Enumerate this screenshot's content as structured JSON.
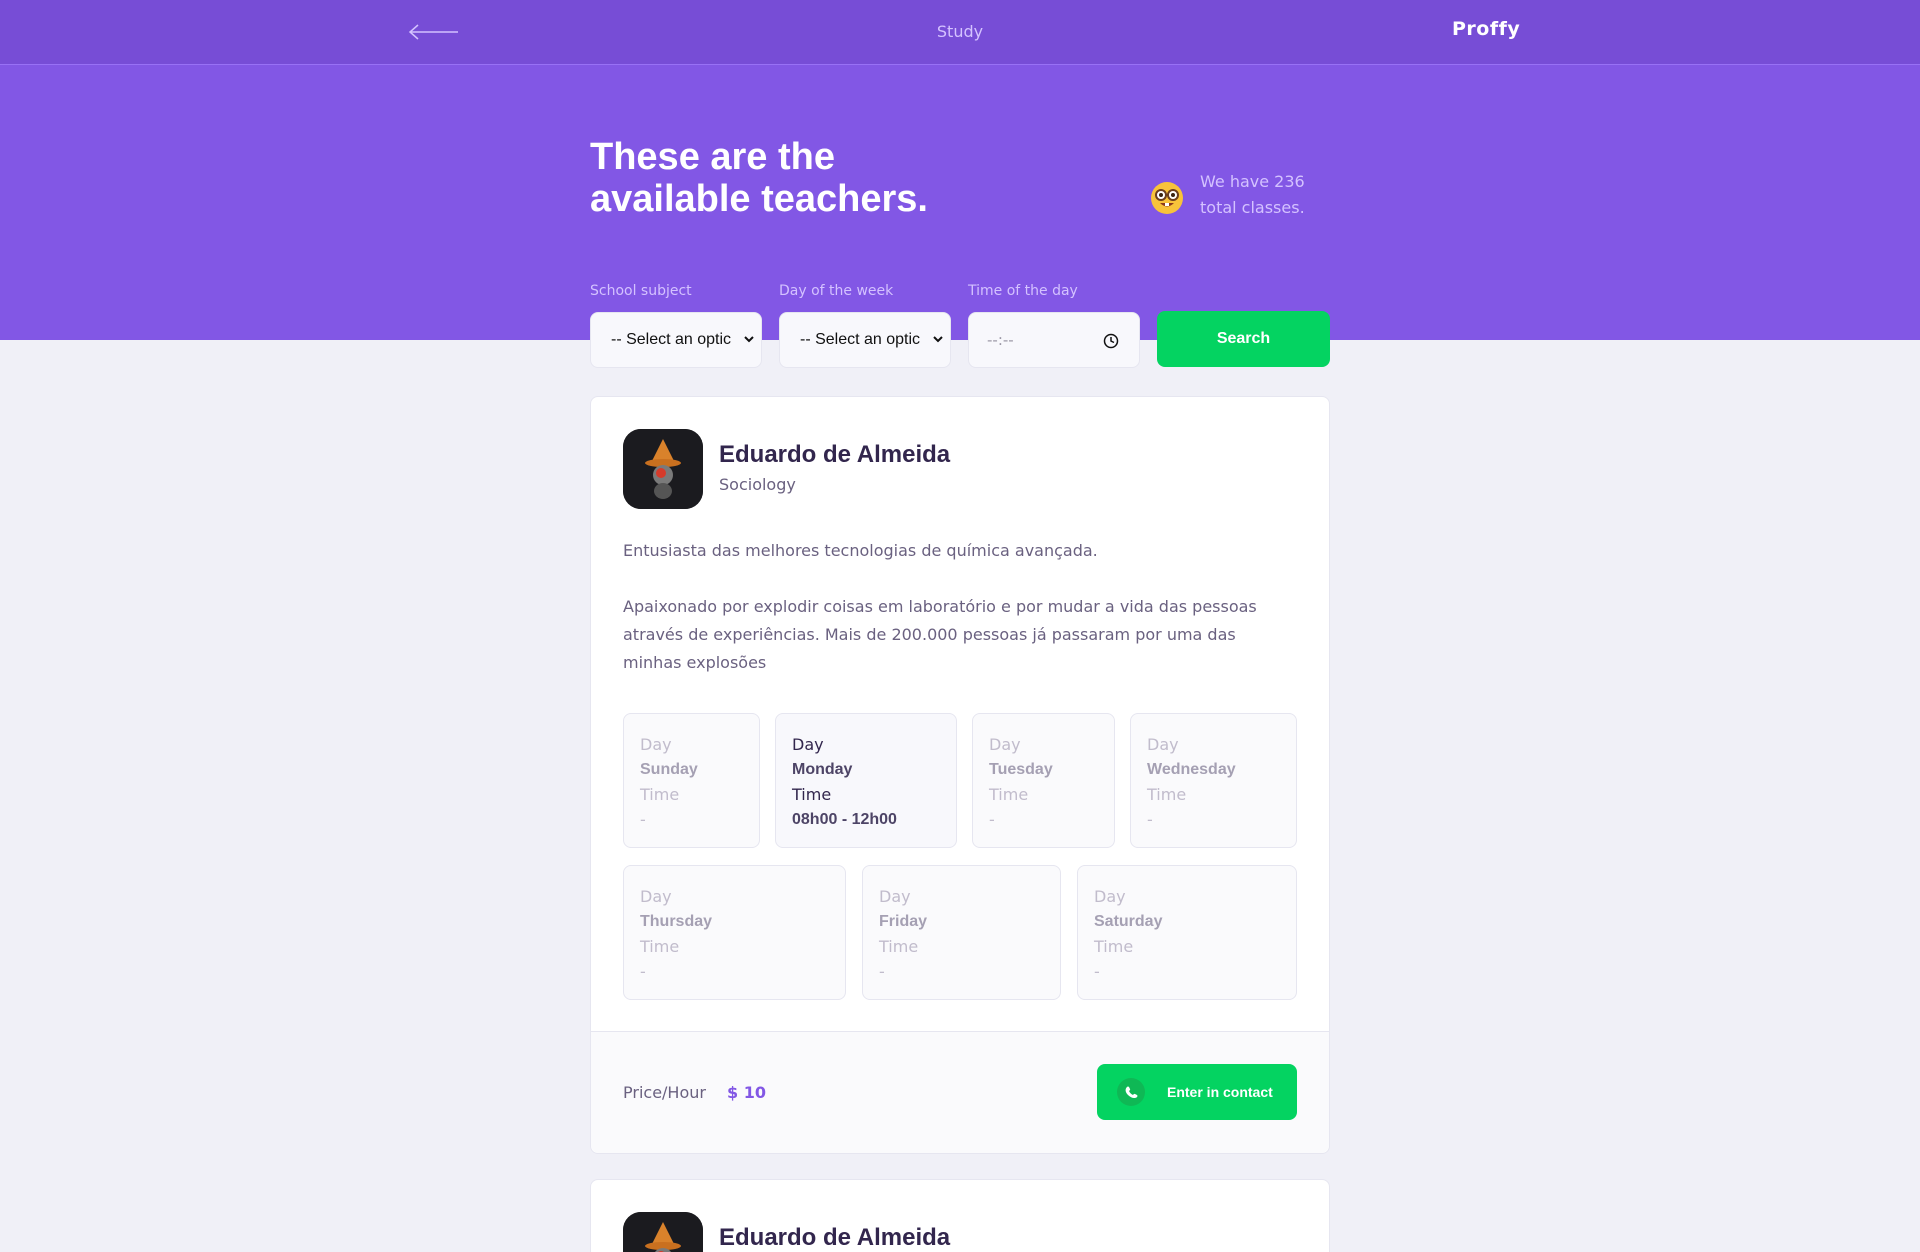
{
  "topbar": {
    "back_icon": "arrow-left-icon",
    "title": "Study",
    "logo": "Proffy"
  },
  "hero": {
    "title_line1": "These are the",
    "title_line2": "available teachers.",
    "info_icon": "nerd-face-emoji-icon",
    "info_line1": "We have 236",
    "info_line2": "total classes."
  },
  "filters": {
    "subject_label": "School subject",
    "subject_value": "-- Select an optic",
    "week_label": "Day of the week",
    "week_value": "-- Select an optic",
    "time_label": "Time of the day",
    "time_value": "--:--",
    "search_label": "Search"
  },
  "teachers": [
    {
      "name": "Eduardo de Almeida",
      "subject": "Sociology",
      "bio_p1": "Entusiasta das melhores tecnologias de química avançada.",
      "bio_p2": "Apaixonado por explodir coisas em laboratório e por mudar a vida das pessoas através de experiências. Mais de 200.000 pessoas já passaram por uma das minhas explosões",
      "schedule": [
        {
          "day_label": "Day",
          "day": "Sunday",
          "time_label": "Time",
          "time": "-"
        },
        {
          "day_label": "Day",
          "day": "Monday",
          "time_label": "Time",
          "time": "08h00 - 12h00"
        },
        {
          "day_label": "Day",
          "day": "Tuesday",
          "time_label": "Time",
          "time": "-"
        },
        {
          "day_label": "Day",
          "day": "Wednesday",
          "time_label": "Time",
          "time": "-"
        },
        {
          "day_label": "Day",
          "day": "Thursday",
          "time_label": "Time",
          "time": "-"
        },
        {
          "day_label": "Day",
          "day": "Friday",
          "time_label": "Time",
          "time": "-"
        },
        {
          "day_label": "Day",
          "day": "Saturday",
          "time_label": "Time",
          "time": "-"
        }
      ],
      "price_label": "Price/Hour",
      "price_value": "$ 10",
      "contact_label": "Enter in contact",
      "contact_icon": "whatsapp-icon"
    },
    {
      "name": "Eduardo de Almeida"
    }
  ],
  "colors": {
    "topbar": "#774DD6",
    "primary": "#8257E5",
    "secondary": "#04D361",
    "background": "#F0F0F7"
  }
}
